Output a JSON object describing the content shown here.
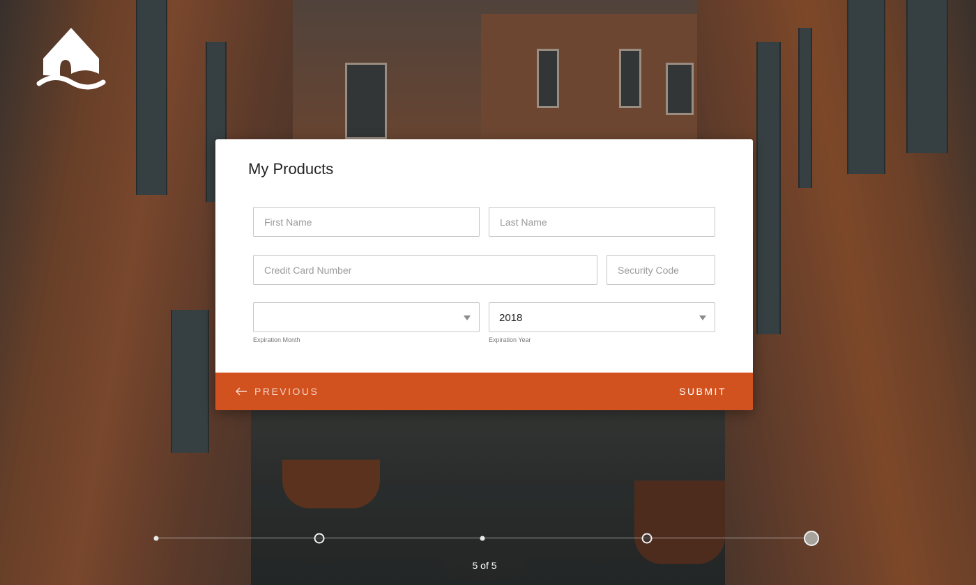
{
  "brand": {
    "logo_icon": "house-on-water-icon"
  },
  "form": {
    "title": "My Products",
    "first_name_placeholder": "First Name",
    "last_name_placeholder": "Last Name",
    "card_number_placeholder": "Credit Card Number",
    "security_code_placeholder": "Security Code",
    "expiration_month_value": "",
    "expiration_month_label": "Expiration Month",
    "expiration_year_value": "2018",
    "expiration_year_label": "Expiration Year"
  },
  "footer": {
    "previous_label": "PREVIOUS",
    "submit_label": "SUBMIT",
    "previous_icon": "arrow-left-icon",
    "accent_color": "#d2521f"
  },
  "progress": {
    "current_step": 5,
    "total_steps": 5,
    "counter_current": "5",
    "counter_of": "of",
    "counter_total": "5"
  }
}
